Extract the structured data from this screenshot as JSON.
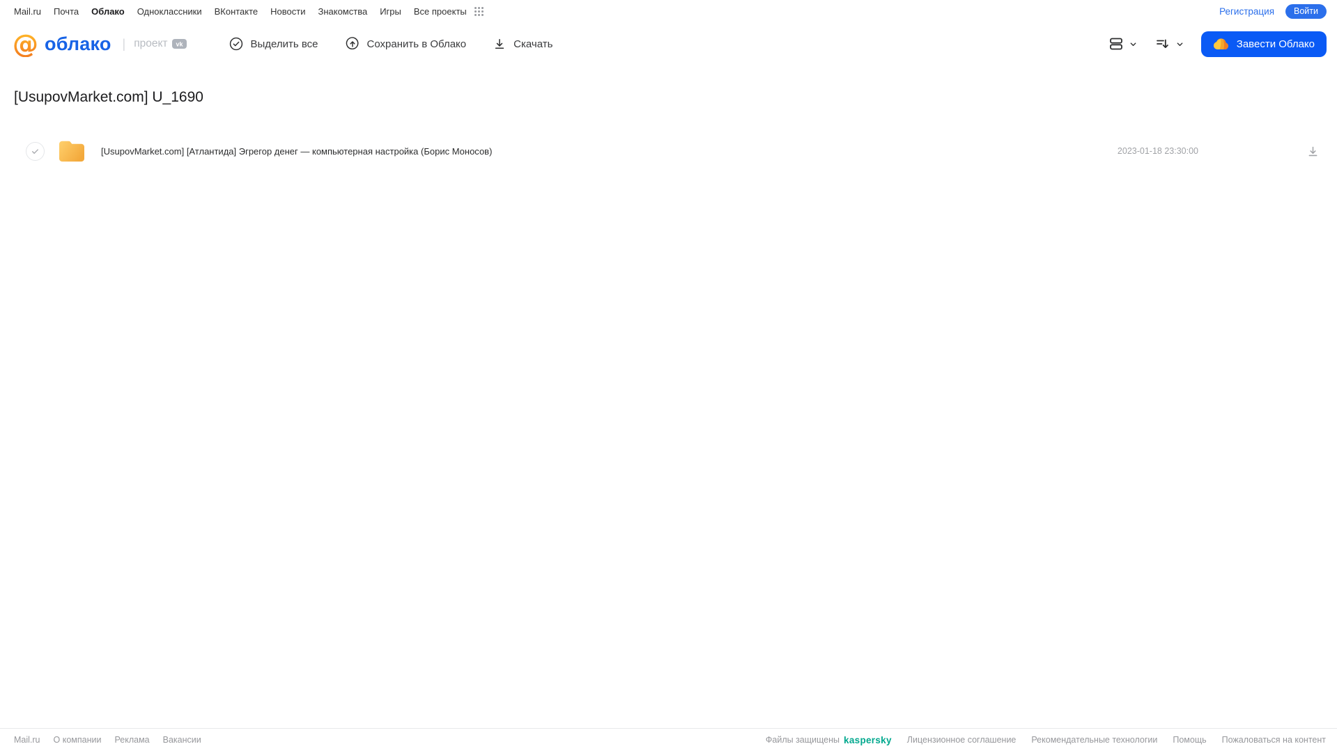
{
  "topnav": {
    "links": [
      {
        "label": "Mail.ru",
        "active": false
      },
      {
        "label": "Почта",
        "active": false
      },
      {
        "label": "Облако",
        "active": true
      },
      {
        "label": "Одноклассники",
        "active": false
      },
      {
        "label": "ВКонтакте",
        "active": false
      },
      {
        "label": "Новости",
        "active": false
      },
      {
        "label": "Знакомства",
        "active": false
      },
      {
        "label": "Игры",
        "active": false
      },
      {
        "label": "Все проекты",
        "active": false
      }
    ],
    "registration_label": "Регистрация",
    "login_label": "Войти"
  },
  "header": {
    "logo_at": "@",
    "logo_text": "облако",
    "project_label": "проект",
    "select_all_label": "Выделить все",
    "save_to_cloud_label": "Сохранить в Облако",
    "download_label": "Скачать",
    "get_cloud_label": "Завести Облако"
  },
  "content": {
    "title": "[UsupovMarket.com] U_1690",
    "files": [
      {
        "type": "folder",
        "name": "[UsupovMarket.com] [Атлантида] Эгрегор денег — компьютерная настройка (Борис Моносов)",
        "date": "2023-01-18 23:30:00"
      }
    ]
  },
  "footer": {
    "left_links": [
      "Mail.ru",
      "О компании",
      "Реклама",
      "Вакансии"
    ],
    "protected_label": "Файлы защищены",
    "kaspersky_label": "kaspersky",
    "right_links": [
      "Лицензионное соглашение",
      "Рекомендательные технологии",
      "Помощь",
      "Пожаловаться на контент"
    ]
  },
  "colors": {
    "brand_orange": "#F48120",
    "logo_blue": "#1763E6",
    "button_blue": "#0A5AF5",
    "login_blue": "#2B6FEB",
    "kaspersky_green": "#00A88E",
    "folder_amber": "#F3A93C",
    "text_primary": "#2C2D2E",
    "text_secondary": "#A0A2A6"
  }
}
